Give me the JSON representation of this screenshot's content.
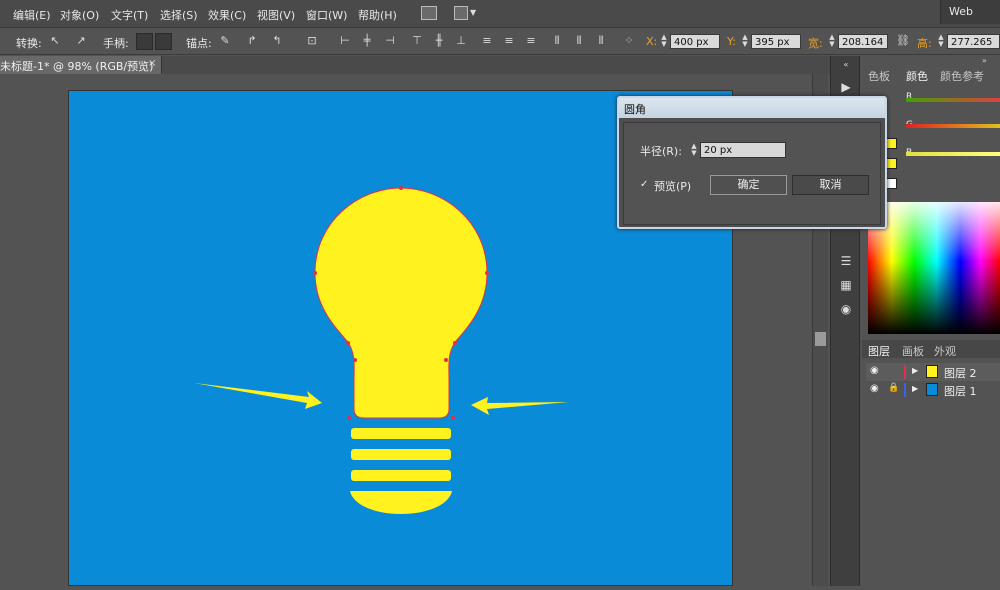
{
  "menubar": {
    "items": [
      "编辑(E)",
      "对象(O)",
      "文字(T)",
      "选择(S)",
      "效果(C)",
      "视图(V)",
      "窗口(W)",
      "帮助(H)"
    ],
    "workspace": "Web"
  },
  "controlbar": {
    "convert_label": "转换:",
    "handle_label": "手柄:",
    "anchor_label": "锚点:",
    "x_key": "X:",
    "x_value": "400 px",
    "y_key": "Y:",
    "y_value": "395 px",
    "w_key": "宽:",
    "w_value": "208.164",
    "h_key": "高:",
    "h_value": "277.265"
  },
  "document": {
    "tab_title": "未标题-1* @ 98% (RGB/预览)",
    "close_glyph": "×"
  },
  "colors": {
    "artboard": "#0a8bd8",
    "bulb": "#fff21f",
    "anchor": "#e0304a",
    "dialog_title": "#c5d3e2"
  },
  "dialog": {
    "title": "圆角",
    "radius_label": "半径(R):",
    "radius_value": "20 px",
    "preview_label": "预览(P)",
    "preview_checked": true,
    "ok_label": "确定",
    "cancel_label": "取消"
  },
  "color_panel": {
    "tabs": [
      "色板",
      "颜色",
      "颜色参考"
    ],
    "active_tab": "颜色",
    "channels": [
      {
        "name": "R",
        "color": "#e04040"
      },
      {
        "name": "G",
        "color": "#40c040"
      },
      {
        "name": "B",
        "color": "#eeee40"
      }
    ]
  },
  "layers_panel": {
    "tabs": [
      "图层",
      "画板",
      "外观"
    ],
    "active_tab": "图层",
    "layers": [
      {
        "name": "图层 2",
        "thumb": "#fff21f",
        "accent": "#e0304a",
        "locked": false
      },
      {
        "name": "图层 1",
        "thumb": "#0a8bd8",
        "accent": "#4060e0",
        "locked": true
      }
    ]
  },
  "icons": [
    "eye-icon",
    "lock-icon",
    "expand-arrow-icon",
    "play-icon",
    "align-icon",
    "pen-anchor-icon"
  ]
}
